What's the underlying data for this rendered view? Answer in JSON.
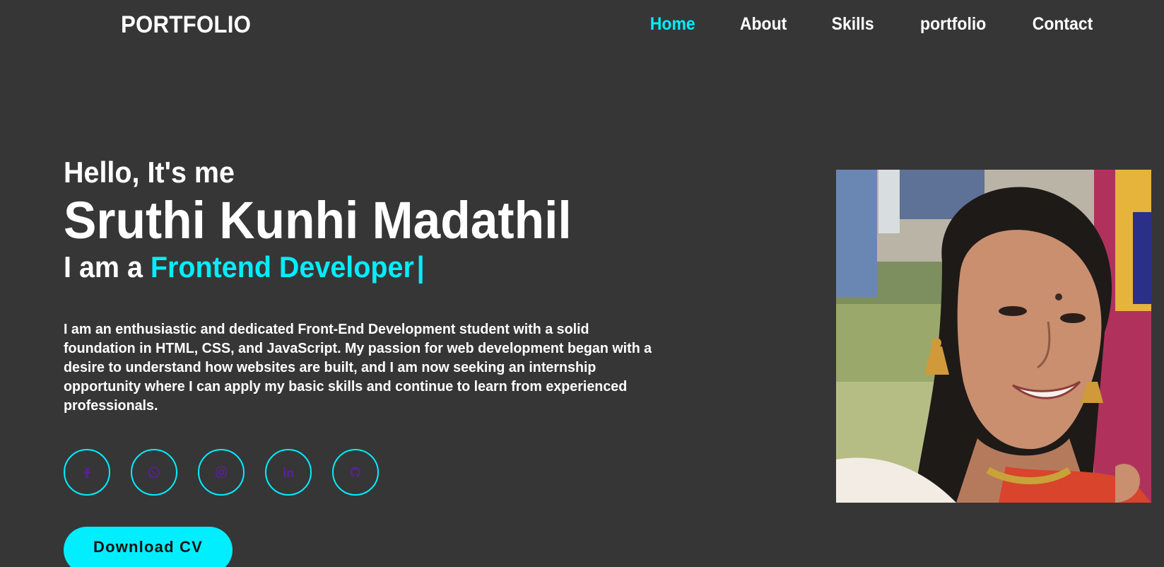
{
  "header": {
    "logo": "PORTFOLIO",
    "nav": [
      {
        "label": "Home",
        "active": true
      },
      {
        "label": "About",
        "active": false
      },
      {
        "label": "Skills",
        "active": false
      },
      {
        "label": "portfolio",
        "active": false
      },
      {
        "label": "Contact",
        "active": false
      }
    ]
  },
  "hero": {
    "greeting": "Hello, It's me",
    "name": "Sruthi Kunhi Madathil",
    "role_prefix": "I am a",
    "role": "Frontend Developer",
    "cursor": "|",
    "bio": "I am an enthusiastic and dedicated Front-End Development student with a solid foundation in HTML, CSS, and JavaScript. My passion for web development began with a desire to understand how websites are built, and I am now seeking an internship opportunity where I can apply my basic skills and continue to learn from experienced professionals."
  },
  "socials": [
    {
      "icon": "facebook-icon"
    },
    {
      "icon": "whatsapp-icon"
    },
    {
      "icon": "instagram-icon"
    },
    {
      "icon": "linkedin-icon"
    },
    {
      "icon": "github-icon"
    }
  ],
  "cta": {
    "download_label": "Download CV"
  },
  "colors": {
    "background": "#363636",
    "accent": "#00eeff",
    "text": "#ffffff",
    "icon": "#5a1f9a"
  }
}
